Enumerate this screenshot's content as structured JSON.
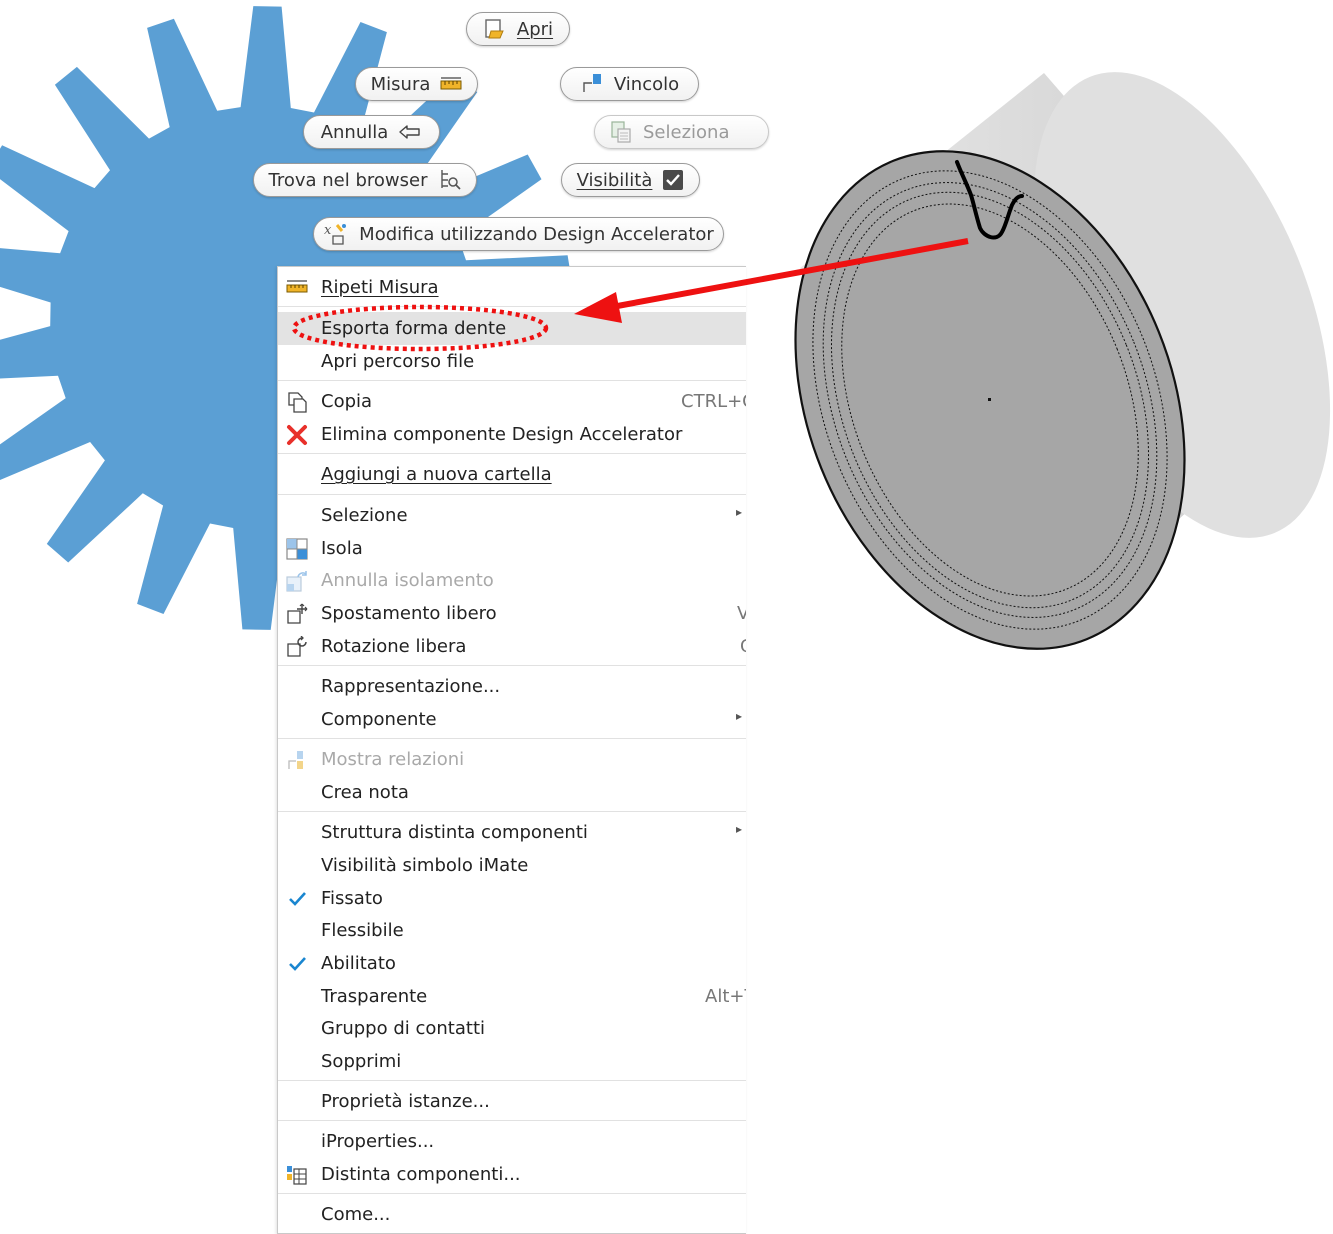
{
  "colors": {
    "gear": "#5b9fd4",
    "arrow": "#ee1111",
    "highlight": "#e3e3e3",
    "check": "#1a86d0",
    "delete": "#e8302a"
  },
  "toolbar": {
    "apri": "Apri",
    "misura": "Misura",
    "vincolo": "Vincolo",
    "annulla": "Annulla",
    "seleziona": "Seleziona",
    "trova": "Trova nel browser",
    "visibilita": "Visibilità",
    "modifica": "Modifica utilizzando Design Accelerator"
  },
  "menu": {
    "ripeti_misura": "Ripeti Misura",
    "esporta_forma_dente": "Esporta forma dente",
    "apri_percorso_file": "Apri percorso file",
    "copia": "Copia",
    "copia_shortcut": "CTRL+C",
    "elimina": "Elimina componente Design Accelerator",
    "aggiungi_cartella": "Aggiungi a nuova cartella",
    "selezione": "Selezione",
    "isola": "Isola",
    "annulla_isolamento": "Annulla isolamento",
    "spostamento_libero": "Spostamento libero",
    "spostamento_shortcut": "V",
    "rotazione_libera": "Rotazione libera",
    "rotazione_shortcut": "G",
    "rappresentazione": "Rappresentazione...",
    "componente": "Componente",
    "mostra_relazioni": "Mostra relazioni",
    "crea_nota": "Crea nota",
    "struttura_distinta": "Struttura distinta componenti",
    "visibilita_imate": "Visibilità simbolo iMate",
    "fissato": "Fissato",
    "flessibile": "Flessibile",
    "abilitato": "Abilitato",
    "trasparente": "Trasparente",
    "trasparente_shortcut": "Alt+T",
    "gruppo_contatti": "Gruppo di contatti",
    "sopprimi": "Sopprimi",
    "proprieta_istanze": "Proprietà istanze...",
    "iproperties": "iProperties...",
    "distinta_componenti": "Distinta componenti...",
    "come": "Come..."
  }
}
